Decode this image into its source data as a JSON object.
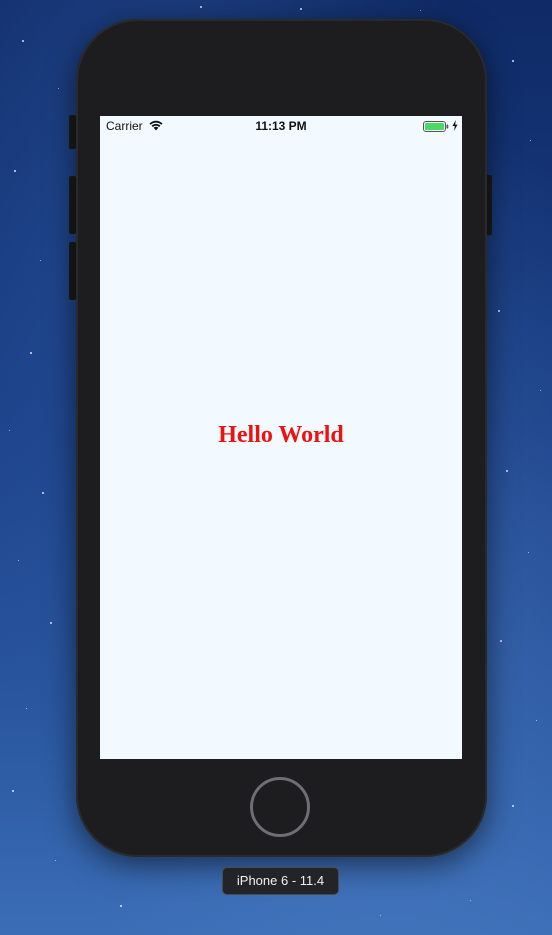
{
  "status_bar": {
    "carrier": "Carrier",
    "time": "11:13 PM",
    "wifi_icon": "wifi-icon",
    "battery_icon": "battery-icon",
    "charge_icon": "charging-bolt-icon",
    "battery_color": "#4cd964"
  },
  "app": {
    "label": "Hello World",
    "label_color": "#ee1111",
    "background_color": "#f3faff"
  },
  "simulator": {
    "device_label": "iPhone 6 - 11.4",
    "home_button_icon": "home-button"
  }
}
